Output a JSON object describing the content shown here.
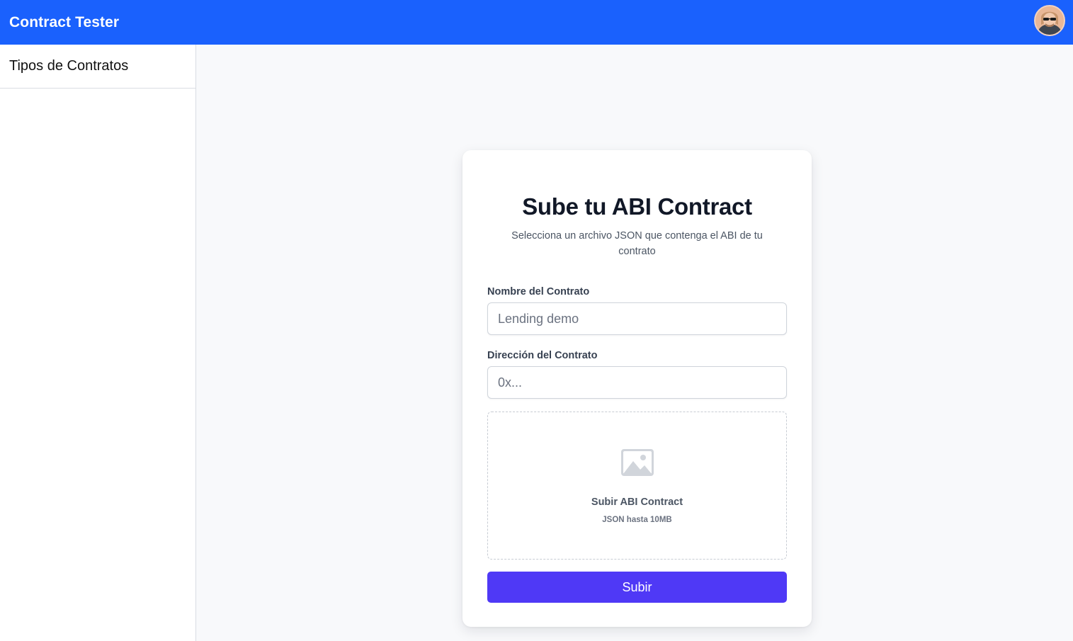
{
  "header": {
    "app_title": "Contract Tester",
    "avatar_icon": "user-avatar"
  },
  "sidebar": {
    "title": "Tipos de Contratos"
  },
  "upload_card": {
    "title": "Sube tu ABI Contract",
    "subtitle": "Selecciona un archivo JSON que contenga el ABI de tu contrato",
    "name_field": {
      "label": "Nombre del Contrato",
      "placeholder": "Lending demo",
      "value": ""
    },
    "address_field": {
      "label": "Dirección del Contrato",
      "placeholder": "0x...",
      "value": ""
    },
    "dropzone": {
      "icon": "image-icon",
      "title": "Subir ABI Contract",
      "hint": "JSON hasta 10MB"
    },
    "submit_label": "Subir"
  },
  "colors": {
    "topbar": "#1a61fd",
    "submit_button": "#4f39f6",
    "page_background": "#f8f9fb"
  }
}
